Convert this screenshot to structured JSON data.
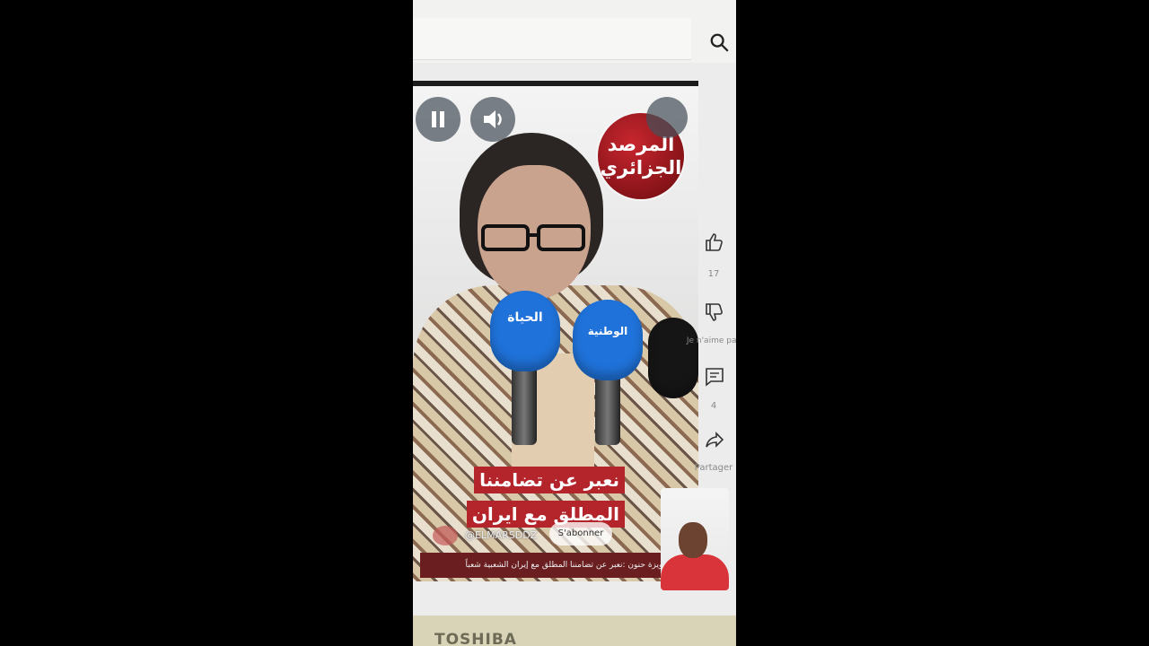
{
  "browser": {
    "search_icon": "search-icon"
  },
  "video": {
    "logo_line1": "المرصد",
    "logo_line2": "الجزائري",
    "mic1_label": "الحياة",
    "mic2_label": "الوطنية",
    "caption_line1": "نعبر عن تضامننا",
    "caption_line2": "المطلق مع ايران",
    "channel_handle": "@ELMARSDDZ",
    "subscribe_label": "S'abonner",
    "description": "لويزة حنون :نعبر عن تضامننا المطلق مع إيران الشعبية شعباً..."
  },
  "actions": {
    "like_count": "17",
    "dislike_label": "Je n'aime pas",
    "comment_count": "4",
    "share_label": "Partager"
  },
  "monitor": {
    "brand": "TOSHIBA"
  },
  "colors": {
    "accent_red": "#b3242b",
    "mic_blue": "#1f72d9"
  }
}
